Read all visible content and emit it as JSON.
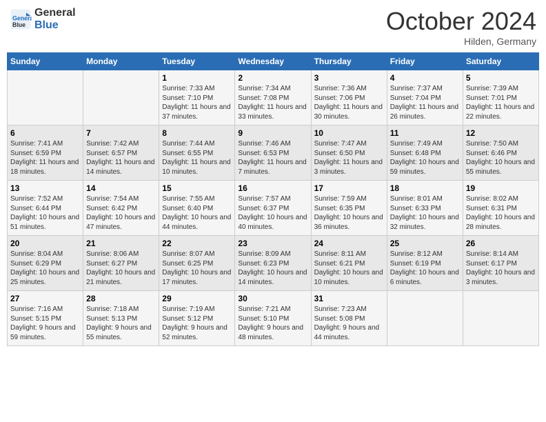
{
  "header": {
    "logo_line1": "General",
    "logo_line2": "Blue",
    "month": "October 2024",
    "location": "Hilden, Germany"
  },
  "weekdays": [
    "Sunday",
    "Monday",
    "Tuesday",
    "Wednesday",
    "Thursday",
    "Friday",
    "Saturday"
  ],
  "weeks": [
    [
      {
        "day": "",
        "info": ""
      },
      {
        "day": "",
        "info": ""
      },
      {
        "day": "1",
        "info": "Sunrise: 7:33 AM\nSunset: 7:10 PM\nDaylight: 11 hours and 37 minutes."
      },
      {
        "day": "2",
        "info": "Sunrise: 7:34 AM\nSunset: 7:08 PM\nDaylight: 11 hours and 33 minutes."
      },
      {
        "day": "3",
        "info": "Sunrise: 7:36 AM\nSunset: 7:06 PM\nDaylight: 11 hours and 30 minutes."
      },
      {
        "day": "4",
        "info": "Sunrise: 7:37 AM\nSunset: 7:04 PM\nDaylight: 11 hours and 26 minutes."
      },
      {
        "day": "5",
        "info": "Sunrise: 7:39 AM\nSunset: 7:01 PM\nDaylight: 11 hours and 22 minutes."
      }
    ],
    [
      {
        "day": "6",
        "info": "Sunrise: 7:41 AM\nSunset: 6:59 PM\nDaylight: 11 hours and 18 minutes."
      },
      {
        "day": "7",
        "info": "Sunrise: 7:42 AM\nSunset: 6:57 PM\nDaylight: 11 hours and 14 minutes."
      },
      {
        "day": "8",
        "info": "Sunrise: 7:44 AM\nSunset: 6:55 PM\nDaylight: 11 hours and 10 minutes."
      },
      {
        "day": "9",
        "info": "Sunrise: 7:46 AM\nSunset: 6:53 PM\nDaylight: 11 hours and 7 minutes."
      },
      {
        "day": "10",
        "info": "Sunrise: 7:47 AM\nSunset: 6:50 PM\nDaylight: 11 hours and 3 minutes."
      },
      {
        "day": "11",
        "info": "Sunrise: 7:49 AM\nSunset: 6:48 PM\nDaylight: 10 hours and 59 minutes."
      },
      {
        "day": "12",
        "info": "Sunrise: 7:50 AM\nSunset: 6:46 PM\nDaylight: 10 hours and 55 minutes."
      }
    ],
    [
      {
        "day": "13",
        "info": "Sunrise: 7:52 AM\nSunset: 6:44 PM\nDaylight: 10 hours and 51 minutes."
      },
      {
        "day": "14",
        "info": "Sunrise: 7:54 AM\nSunset: 6:42 PM\nDaylight: 10 hours and 47 minutes."
      },
      {
        "day": "15",
        "info": "Sunrise: 7:55 AM\nSunset: 6:40 PM\nDaylight: 10 hours and 44 minutes."
      },
      {
        "day": "16",
        "info": "Sunrise: 7:57 AM\nSunset: 6:37 PM\nDaylight: 10 hours and 40 minutes."
      },
      {
        "day": "17",
        "info": "Sunrise: 7:59 AM\nSunset: 6:35 PM\nDaylight: 10 hours and 36 minutes."
      },
      {
        "day": "18",
        "info": "Sunrise: 8:01 AM\nSunset: 6:33 PM\nDaylight: 10 hours and 32 minutes."
      },
      {
        "day": "19",
        "info": "Sunrise: 8:02 AM\nSunset: 6:31 PM\nDaylight: 10 hours and 28 minutes."
      }
    ],
    [
      {
        "day": "20",
        "info": "Sunrise: 8:04 AM\nSunset: 6:29 PM\nDaylight: 10 hours and 25 minutes."
      },
      {
        "day": "21",
        "info": "Sunrise: 8:06 AM\nSunset: 6:27 PM\nDaylight: 10 hours and 21 minutes."
      },
      {
        "day": "22",
        "info": "Sunrise: 8:07 AM\nSunset: 6:25 PM\nDaylight: 10 hours and 17 minutes."
      },
      {
        "day": "23",
        "info": "Sunrise: 8:09 AM\nSunset: 6:23 PM\nDaylight: 10 hours and 14 minutes."
      },
      {
        "day": "24",
        "info": "Sunrise: 8:11 AM\nSunset: 6:21 PM\nDaylight: 10 hours and 10 minutes."
      },
      {
        "day": "25",
        "info": "Sunrise: 8:12 AM\nSunset: 6:19 PM\nDaylight: 10 hours and 6 minutes."
      },
      {
        "day": "26",
        "info": "Sunrise: 8:14 AM\nSunset: 6:17 PM\nDaylight: 10 hours and 3 minutes."
      }
    ],
    [
      {
        "day": "27",
        "info": "Sunrise: 7:16 AM\nSunset: 5:15 PM\nDaylight: 9 hours and 59 minutes."
      },
      {
        "day": "28",
        "info": "Sunrise: 7:18 AM\nSunset: 5:13 PM\nDaylight: 9 hours and 55 minutes."
      },
      {
        "day": "29",
        "info": "Sunrise: 7:19 AM\nSunset: 5:12 PM\nDaylight: 9 hours and 52 minutes."
      },
      {
        "day": "30",
        "info": "Sunrise: 7:21 AM\nSunset: 5:10 PM\nDaylight: 9 hours and 48 minutes."
      },
      {
        "day": "31",
        "info": "Sunrise: 7:23 AM\nSunset: 5:08 PM\nDaylight: 9 hours and 44 minutes."
      },
      {
        "day": "",
        "info": ""
      },
      {
        "day": "",
        "info": ""
      }
    ]
  ]
}
